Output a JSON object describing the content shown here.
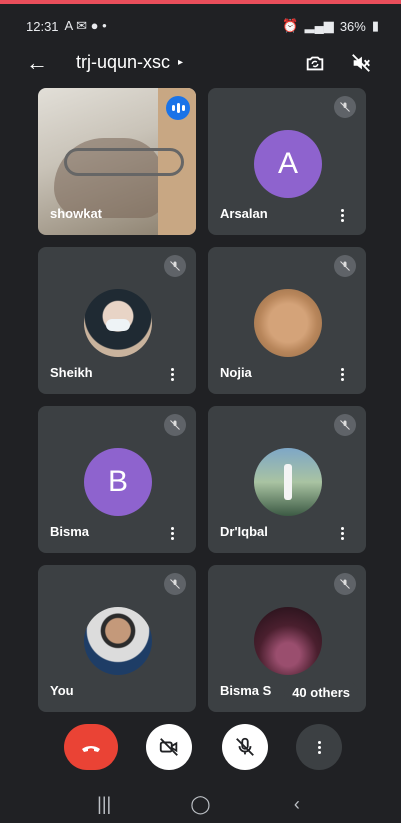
{
  "status_bar": {
    "time": "12:31",
    "battery": "36%"
  },
  "header": {
    "meeting_code": "trj-uqun-xsc"
  },
  "participants": [
    {
      "name": "showkat",
      "type": "video",
      "speaking": true
    },
    {
      "name": "Arsalan",
      "type": "letter",
      "letter": "A",
      "muted": true
    },
    {
      "name": "Sheikh",
      "type": "photo",
      "muted": true
    },
    {
      "name": "Nojia",
      "type": "photo",
      "muted": true
    },
    {
      "name": "Bisma",
      "type": "letter",
      "letter": "B",
      "muted": true
    },
    {
      "name": "Dr'Iqbal",
      "type": "photo",
      "muted": true
    },
    {
      "name": "You",
      "type": "photo",
      "muted": true
    },
    {
      "name": "Bisma S",
      "type": "photo",
      "muted": true,
      "others_label": "40 others"
    }
  ],
  "colors": {
    "end_call": "#ea4335",
    "avatar_letter_bg": "#8e63ce",
    "speaking": "#1a73e8",
    "tile_bg": "#3c4043"
  }
}
